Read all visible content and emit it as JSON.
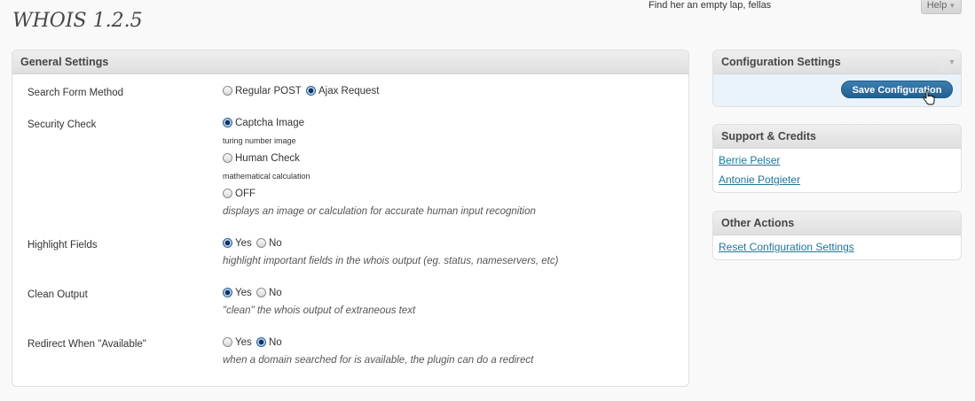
{
  "header": {
    "top_message": "Find her an empty lap, fellas",
    "help_label": "Help",
    "page_title": "WHOIS 1.2.5"
  },
  "general": {
    "title": "General Settings",
    "search_method": {
      "label": "Search Form Method",
      "options": [
        "Regular POST",
        "Ajax Request"
      ],
      "selected": "Ajax Request"
    },
    "security": {
      "label": "Security Check",
      "options": [
        {
          "label": "Captcha Image",
          "note": "turing number image"
        },
        {
          "label": "Human Check",
          "note": "mathematical calculation"
        },
        {
          "label": "OFF",
          "note": ""
        }
      ],
      "selected": "Captcha Image",
      "description": "displays an image or calculation for accurate human input recognition"
    },
    "highlight": {
      "label": "Highlight Fields",
      "options": [
        "Yes",
        "No"
      ],
      "selected": "Yes",
      "description": "highlight important fields in the whois output (eg. status, nameservers, etc)"
    },
    "clean": {
      "label": "Clean Output",
      "options": [
        "Yes",
        "No"
      ],
      "selected": "Yes",
      "description": "\"clean\" the whois output of extraneous text"
    },
    "redirect": {
      "label": "Redirect When \"Available\"",
      "options": [
        "Yes",
        "No"
      ],
      "selected": "No",
      "description": "when a domain searched for is available, the plugin can do a redirect"
    }
  },
  "config": {
    "title": "Configuration Settings",
    "save_label": "Save Configuration"
  },
  "support": {
    "title": "Support & Credits",
    "links": [
      "Berrie Pelser",
      "Antonie Potgieter"
    ]
  },
  "other": {
    "title": "Other Actions",
    "links": [
      "Reset Configuration Settings"
    ]
  },
  "colors": {
    "link": "#21759b",
    "button": "#21608f",
    "config_body": "#eaf2fa"
  }
}
